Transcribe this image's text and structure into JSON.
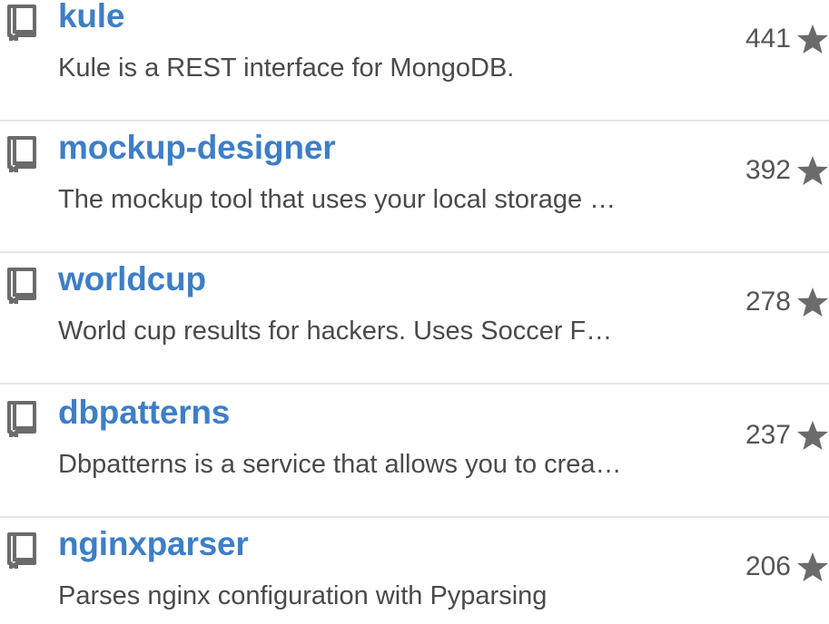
{
  "colors": {
    "link": "#3d7ec8",
    "text": "#4a4a4a",
    "count": "#555555",
    "icon": "#6b6b6b",
    "divider": "#e6e6e6"
  },
  "repos": [
    {
      "name": "kule",
      "description": "Kule is a REST interface for MongoDB.",
      "stars": "441",
      "icon": "repo-book-icon",
      "star_icon": "star-icon"
    },
    {
      "name": "mockup-designer",
      "description": "The mockup tool that uses your local storage …",
      "stars": "392",
      "icon": "repo-book-icon",
      "star_icon": "star-icon"
    },
    {
      "name": "worldcup",
      "description": "World cup results for hackers. Uses Soccer F…",
      "stars": "278",
      "icon": "repo-book-icon",
      "star_icon": "star-icon"
    },
    {
      "name": "dbpatterns",
      "description": "Dbpatterns is a service that allows you to crea…",
      "stars": "237",
      "icon": "repo-book-icon",
      "star_icon": "star-icon"
    },
    {
      "name": "nginxparser",
      "description": "Parses nginx configuration with Pyparsing",
      "stars": "206",
      "icon": "repo-book-icon",
      "star_icon": "star-icon"
    }
  ]
}
